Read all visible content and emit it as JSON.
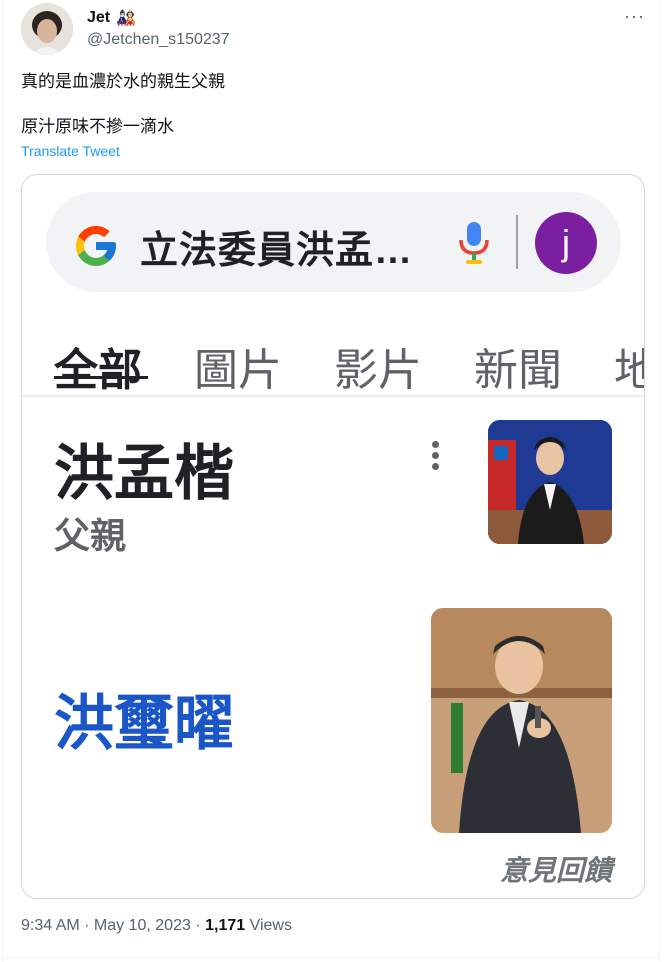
{
  "tweet": {
    "author_name": "Jet",
    "author_emoji": "🎎",
    "handle": "@Jetchen_s150237",
    "more": "···",
    "line1": "真的是血濃於水的親生父親",
    "line2": "原汁原味不摻一滴水",
    "translate": "Translate Tweet"
  },
  "google": {
    "query": "立法委員洪孟…",
    "account_letter": "j",
    "tabs": [
      {
        "label": "全部",
        "active": true
      },
      {
        "label": "圖片"
      },
      {
        "label": "影片"
      },
      {
        "label": "新聞"
      },
      {
        "label": "地"
      }
    ],
    "result1_name": "洪孟楷",
    "result1_role": "父親",
    "result2_name": "洪璽曜",
    "feedback": "意見回饋"
  },
  "meta": {
    "time": "9:34 AM",
    "sep1": " · ",
    "date": "May 10, 2023",
    "sep2": " · ",
    "views_count": "1,171",
    "views_label": " Views"
  },
  "colors": {
    "link": "#1d9bf0",
    "google_link": "#1a56c8",
    "account": "#7b1fa2"
  }
}
